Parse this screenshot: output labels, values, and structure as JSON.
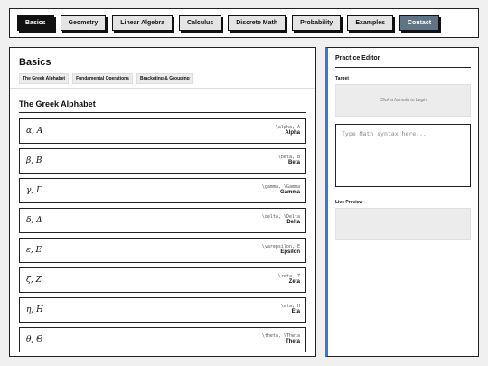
{
  "nav": [
    {
      "label": "Basics",
      "active": true
    },
    {
      "label": "Geometry"
    },
    {
      "label": "Linear Algebra"
    },
    {
      "label": "Calculus"
    },
    {
      "label": "Discrete Math"
    },
    {
      "label": "Probability"
    },
    {
      "label": "Examples"
    },
    {
      "label": "Contact",
      "accent": true
    }
  ],
  "main": {
    "title": "Basics",
    "subnav": [
      "The Greek Alphabet",
      "Fundamental Operations",
      "Bracketing & Grouping"
    ],
    "section_title": "The Greek Alphabet",
    "cards": [
      {
        "formula": "α, A",
        "syntax": "\\alpha, A",
        "name": "Alpha"
      },
      {
        "formula": "β, B",
        "syntax": "\\beta, B",
        "name": "Beta"
      },
      {
        "formula": "γ, Γ",
        "syntax": "\\gamma, \\Gamma",
        "name": "Gamma"
      },
      {
        "formula": "δ, Δ",
        "syntax": "\\delta, \\Delta",
        "name": "Delta"
      },
      {
        "formula": "ε, E",
        "syntax": "\\varepsilon, E",
        "name": "Epsilon"
      },
      {
        "formula": "ζ, Z",
        "syntax": "\\zeta, Z",
        "name": "Zeta"
      },
      {
        "formula": "η, H",
        "syntax": "\\eta, H",
        "name": "Eta"
      },
      {
        "formula": "θ, Θ",
        "syntax": "\\theta, \\Theta",
        "name": "Theta"
      }
    ]
  },
  "editor": {
    "title": "Practice Editor",
    "target_label": "Target",
    "target_placeholder": "Click a formula to begin",
    "input_placeholder": "Type Math syntax here...",
    "preview_label": "Live Preview"
  },
  "colors": {
    "accent_blue": "#2f7bd6",
    "contact_button": "#5f7585",
    "active_button": "#111111"
  }
}
